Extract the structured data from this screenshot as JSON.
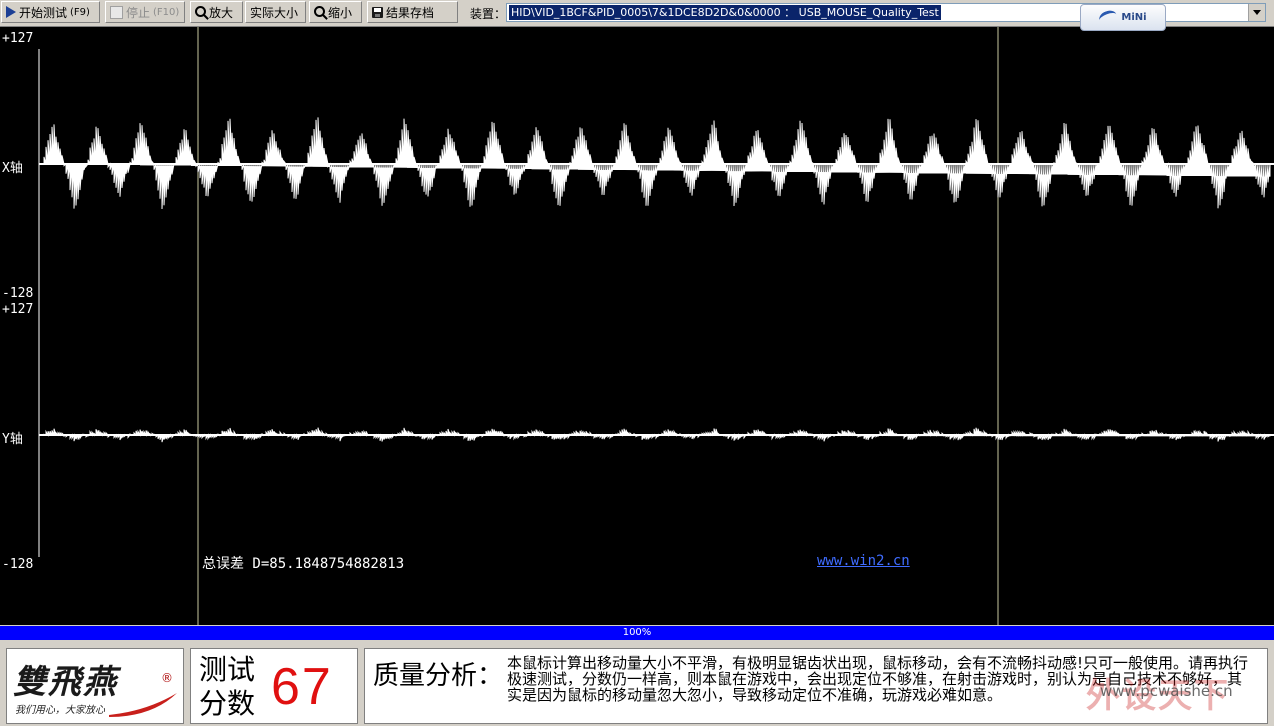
{
  "toolbar": {
    "start_label": "开始测试",
    "start_shortcut": "(F9)",
    "stop_label": "停止",
    "stop_shortcut": "(F10)",
    "zoom_in_label": "放大",
    "actual_size_label": "实际大小",
    "zoom_out_label": "缩小",
    "save_label": "结果存档",
    "device_label": "装置：",
    "device_value": "HID\\VID_1BCF&PID_0005\\7&1DCE8D2D&0&0000 ： USB_MOUSE_Quality_Test",
    "mini_label": "MiNi"
  },
  "scope": {
    "x_axis": {
      "label": "X轴",
      "max_label": "+127",
      "min_label": "-128"
    },
    "y_axis": {
      "label": "Y轴",
      "max_label": "+127",
      "min_label": "-128"
    },
    "error_text": "总误差 D=85.1848754882813",
    "site_link": "www.win2.cn",
    "colors": {
      "background": "#000000",
      "signal": "#ffffff",
      "marker": "#c8c8a0"
    }
  },
  "progress": {
    "label": "100%",
    "value": 1.0
  },
  "bottom": {
    "logo_title": "雙飛燕",
    "logo_reg": "®",
    "logo_slogan": "我们用心，大家放心",
    "score_label_line1": "测试",
    "score_label_line2": "分数",
    "score_value": "67",
    "analysis_label": "质量分析：",
    "analysis_text": "本鼠标计算出移动量大小不平滑，有极明显锯齿状出现，鼠标移动，会有不流畅抖动感!只可一般使用。请再执行极速测试，分数仍一样高，则本鼠在游戏中，会出现定位不够准，在射击游戏时，别认为是自己技术不够好，其实是因为鼠标的移动量忽大忽小，导致移动定位不准确，玩游戏必难如意。",
    "site_mark": "外设天下",
    "site_url": "www.pcwaishe.cn"
  }
}
